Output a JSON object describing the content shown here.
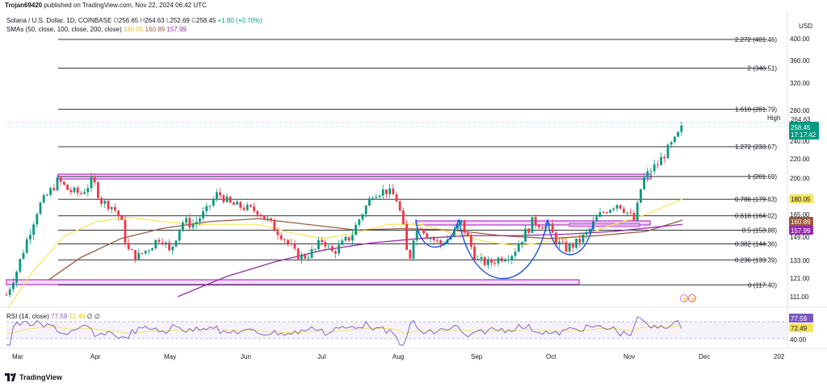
{
  "topbar": {
    "author": "Trojan69420",
    "text": " published on TradingView.com, Nov 22, 2024 06:42 UTC"
  },
  "header": {
    "symbol": "Solana / U.S. Dollar, 1D, COINBASE",
    "o_label": "O",
    "o": "256.65",
    "h_label": "H",
    "h": "264.63",
    "l_label": "L",
    "l": "252.69",
    "c_label": "C",
    "c": "258.45",
    "chg": "+1.80 (+0.70%)",
    "sma_title": "SMAs (50, close, 100, close, 200, close)",
    "sma50": "180.05",
    "sma100": "160.89",
    "sma200": "157.99",
    "sma_colors": {
      "sma50": "#f7e45c",
      "sma100": "#9b5a3c",
      "sma200": "#9c27b0"
    }
  },
  "currency": "USD",
  "price_axis": {
    "ticks": [
      "400.00",
      "360.00",
      "320.00",
      "280.00",
      "240.00",
      "220.00",
      "200.00",
      "165.00",
      "149.00",
      "133.00",
      "121.00",
      "111.00"
    ],
    "tick_values": [
      400,
      360,
      320,
      280,
      240,
      220,
      200,
      165,
      149,
      133,
      121,
      111
    ]
  },
  "fib_levels": [
    {
      "label": "2.272 (401.46)",
      "price": 401.46
    },
    {
      "label": "2 (346.51)",
      "price": 346.51
    },
    {
      "label": "1.618 (281.79)",
      "price": 281.79
    },
    {
      "label": "1.272 (233.67)",
      "price": 233.67
    },
    {
      "label": "1 (201.69)",
      "price": 201.69
    },
    {
      "label": "0.786 (179.63)",
      "price": 179.63
    },
    {
      "label": "0.618 (164.02)",
      "price": 164.02
    },
    {
      "label": "0.5 (153.88)",
      "price": 153.88
    },
    {
      "label": "0.382 (144.36)",
      "price": 144.36
    },
    {
      "label": "0.236 (133.39)",
      "price": 133.39
    },
    {
      "label": "0 (117.40)",
      "price": 117.4
    }
  ],
  "badges": {
    "high_label": "High",
    "high": "264.63",
    "price": "258.45",
    "countdown": "17:17:42",
    "sma50": "180.05",
    "sma100": "160.89",
    "sma200": "157.99",
    "rsi1": "77.59",
    "rsi2": "72.49",
    "rsi_tick": "40.00"
  },
  "rsi": {
    "title": "RSI (14, close)",
    "value1": "77.59",
    "value2": "72.49",
    "extra": "∅  ∅"
  },
  "time_axis": [
    "Mar",
    "Apr",
    "May",
    "Jun",
    "Jul",
    "Aug",
    "Sep",
    "Oct",
    "Nov",
    "Dec",
    "202"
  ],
  "footer": {
    "brand": "TradingView"
  },
  "colors": {
    "up": "#089981",
    "down": "#f23645",
    "sma50": "#f7e45c",
    "sma100": "#9b5a3c",
    "sma200": "#9c27b0",
    "box": "#c054d8",
    "pattern": "#1e53e5",
    "rsi": "#7e57c2"
  }
}
